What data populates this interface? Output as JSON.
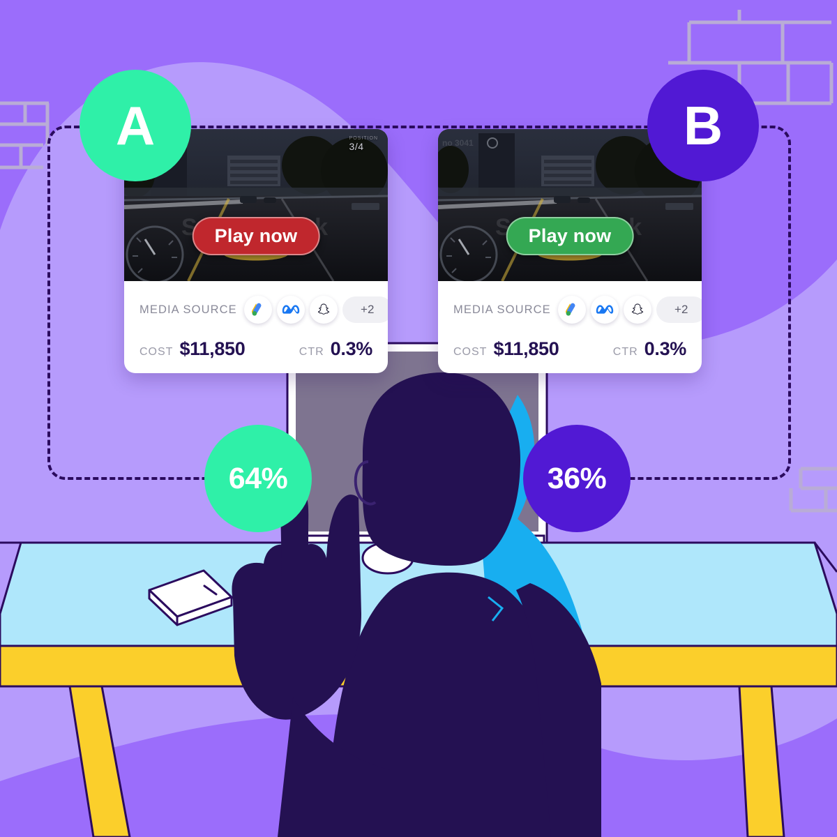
{
  "scene": {
    "title": "A/B creative test illustration",
    "colors": {
      "background": "#9B6DFB",
      "background_wave": "#B69BFC",
      "accent_green": "#2FF0A8",
      "accent_purple": "#5119D4",
      "dark_navy": "#241152",
      "rim_light": "#18AEF0",
      "desk_top": "#AFE7FB",
      "desk_edge": "#FBCF2B",
      "outline": "#2B0B5E",
      "card_white": "#FFFFFF"
    }
  },
  "frame": {
    "style": "dashed",
    "label": "experiment-frame"
  },
  "variants": [
    {
      "badge": "A",
      "badge_color": "#2FF0A8",
      "cta_label": "Play now",
      "cta_color": "#C0272D",
      "position_label": "3/4",
      "position_caption": "POSITION",
      "media_source_label": "MEDIA SOURCE",
      "media_sources": [
        "google-ads-icon",
        "meta-icon",
        "snapchat-icon"
      ],
      "media_sources_more": "+2",
      "metrics": [
        {
          "name": "COST",
          "value": "$11,850"
        },
        {
          "name": "CTR",
          "value": "0.3%"
        }
      ],
      "share": "64%",
      "share_color": "#2FF0A8"
    },
    {
      "badge": "B",
      "badge_color": "#5119D4",
      "cta_label": "Play now",
      "cta_color": "#34A853",
      "position_label": "",
      "position_caption": "",
      "media_source_label": "MEDIA SOURCE",
      "media_sources": [
        "google-ads-icon",
        "meta-icon",
        "snapchat-icon"
      ],
      "media_sources_more": "+2",
      "metrics": [
        {
          "name": "COST",
          "value": "$11,850"
        },
        {
          "name": "CTR",
          "value": "0.3%"
        }
      ],
      "share": "36%",
      "share_color": "#5119D4"
    }
  ],
  "chart_data": {
    "type": "pie",
    "title": "A/B test winner share",
    "categories": [
      "A",
      "B"
    ],
    "values": [
      64,
      36
    ],
    "labels": [
      "64%",
      "36%"
    ],
    "colors": [
      "#2FF0A8",
      "#5119D4"
    ],
    "xlabel": "",
    "ylabel": "",
    "legend": "none"
  },
  "props": {
    "phone": "smartphone-on-desk",
    "monitor": "desktop-monitor",
    "person": "person-silhouette-pointing-up"
  }
}
